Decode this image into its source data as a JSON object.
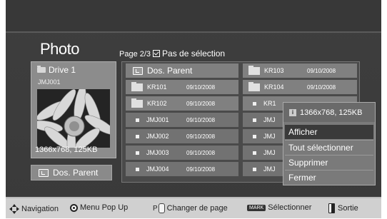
{
  "screen": {
    "title": "Photo"
  },
  "header": {
    "page_label": "Page 2/3",
    "selection_label": "Pas de sélection"
  },
  "preview": {
    "drive_label": "Drive 1",
    "file_name": "JMJ001",
    "resolution": "1366x768, 125KB"
  },
  "parent_button": {
    "label": "Dos. Parent"
  },
  "grid": {
    "left": [
      {
        "type": "parent",
        "name": "Dos. Parent",
        "date": ""
      },
      {
        "type": "folder",
        "name": "KR101",
        "date": "09/10/2008"
      },
      {
        "type": "folder",
        "name": "KR102",
        "date": "09/10/2008"
      },
      {
        "type": "file",
        "name": "JMJ001",
        "date": "09/10/2008"
      },
      {
        "type": "file",
        "name": "JMJ002",
        "date": "09/10/2008"
      },
      {
        "type": "file",
        "name": "JMJ003",
        "date": "09/10/2008"
      },
      {
        "type": "file",
        "name": "JMJ004",
        "date": "09/10/2008"
      }
    ],
    "right": [
      {
        "type": "folder",
        "name": "KR103",
        "date": "09/10/2008"
      },
      {
        "type": "folder",
        "name": "KR104",
        "date": "09/10/2008"
      },
      {
        "type": "file",
        "name": "KR1",
        "date": ""
      },
      {
        "type": "file",
        "name": "JMJ",
        "date": ""
      },
      {
        "type": "file",
        "name": "JMJ",
        "date": ""
      },
      {
        "type": "file",
        "name": "JMJ",
        "date": ""
      },
      {
        "type": "file",
        "name": "JMJ",
        "date": ""
      }
    ]
  },
  "popup": {
    "info": "1366x768, 125KB",
    "items": [
      "Afficher",
      "Tout sélectionner",
      "Supprimer",
      "Fermer"
    ]
  },
  "footer": {
    "navigation": "Navigation",
    "menu_popup": "Menu Pop Up",
    "page_key": "P",
    "change_page": "Changer de page",
    "mark_key": "MARK",
    "select": "Sélectionner",
    "exit": "Sortie"
  }
}
